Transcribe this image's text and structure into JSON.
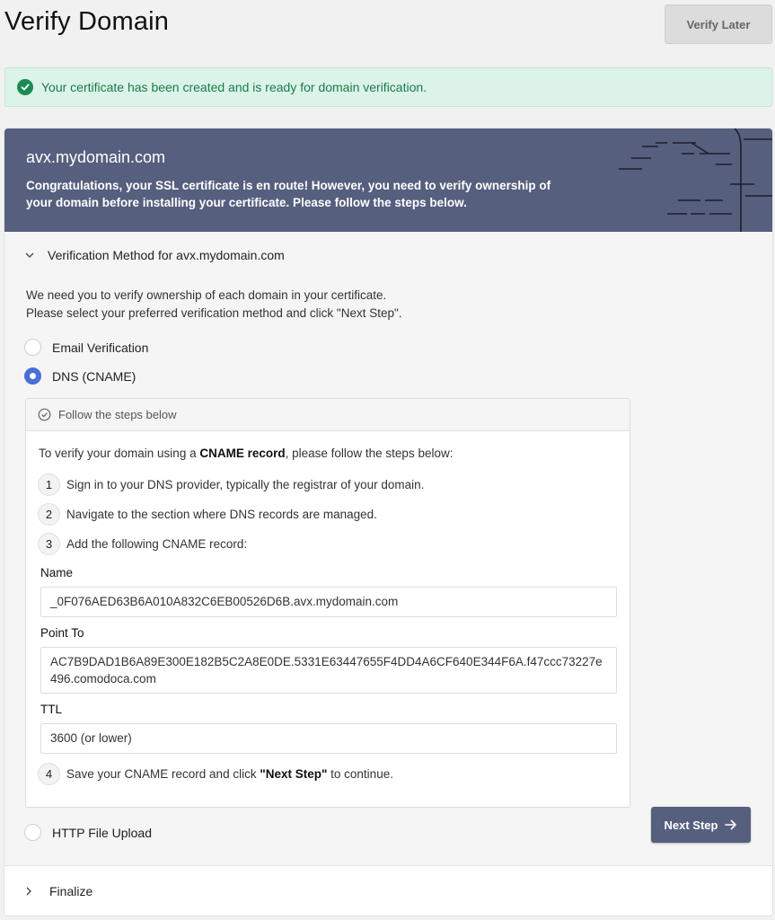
{
  "page": {
    "title": "Verify Domain"
  },
  "header": {
    "verify_later_label": "Verify Later"
  },
  "alert": {
    "text": "Your certificate has been created and is ready for domain verification.",
    "icon": "check-circle-icon",
    "color": "#1c8a55"
  },
  "banner": {
    "domain": "avx.mydomain.com",
    "message": "Congratulations, your SSL certificate is en route! However, you need to verify ownership of your domain before installing your certificate. Please follow the steps below.",
    "background": "#575f7e"
  },
  "verification": {
    "section_title": "Verification Method for avx.mydomain.com",
    "intro_line1": "We need you to verify ownership of each domain in your certificate.",
    "intro_line2": "Please select your preferred verification method and click \"Next Step\".",
    "options": [
      {
        "label": "Email Verification",
        "selected": false
      },
      {
        "label": "DNS (CNAME)",
        "selected": true
      },
      {
        "label": "HTTP File Upload",
        "selected": false
      }
    ]
  },
  "steps": {
    "header": "Follow the steps below",
    "intro_prefix": "To verify your domain using a ",
    "intro_bold": "CNAME record",
    "intro_suffix": ", please follow the steps below:",
    "items": [
      {
        "num": "1",
        "text": "Sign in to your DNS provider, typically the registrar of your domain."
      },
      {
        "num": "2",
        "text": "Navigate to the section where DNS records are managed."
      },
      {
        "num": "3",
        "text": "Add the following CNAME record:"
      },
      {
        "num": "4",
        "text_prefix": "Save your CNAME record and click ",
        "text_bold": "\"Next Step\"",
        "text_suffix": " to continue."
      }
    ],
    "record": {
      "name_label": "Name",
      "name_value": "_0F076AED63B6A010A832C6EB00526D6B.avx.mydomain.com",
      "point_to_label": "Point To",
      "point_to_value": "AC7B9DAD1B6A89E300E182B5C2A8E0DE.5331E63447655F4DD4A6CF640E344F6A.f47ccc73227e496.comodoca.com",
      "ttl_label": "TTL",
      "ttl_value": "3600 (or lower)"
    }
  },
  "actions": {
    "next_step_label": "Next Step"
  },
  "finalize": {
    "label": "Finalize"
  },
  "colors": {
    "accent": "#575f7e",
    "radio_selected": "#4a6fd6",
    "success_bg": "#dcf3e8"
  }
}
